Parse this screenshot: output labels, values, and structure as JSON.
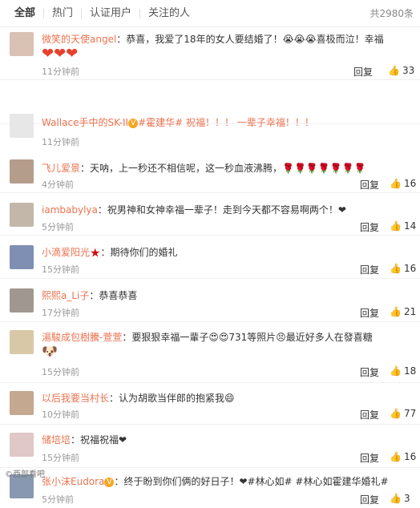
{
  "tabs": [
    {
      "label": "全部"
    },
    {
      "label": "热门"
    },
    {
      "label": "认证用户"
    },
    {
      "label": "关注的人"
    }
  ],
  "total_count": "共2980条",
  "reply_label": "回复",
  "comments": [
    {
      "user": "微笑的天使angel",
      "text": "：恭喜，我爱了18年的女人要结婚了！😭😭😭喜极而泣！幸福",
      "tail": "❤❤❤",
      "time": "11分钟前",
      "likes": "33",
      "avatar_color": "#d9c1b3"
    },
    {
      "user": "Wallace手中的SK-II",
      "text": "#霍建华# 祝福！！！ 一辈子幸福！！！",
      "time": "11分钟前",
      "likes": "",
      "avatar_color": "#e7e7e7"
    },
    {
      "user": "飞儿爱景",
      "text": "：天呐，上一秒还不相信呢，这一秒血液沸腾，🌹🌹🌹🌹🌹🌹🌹",
      "time": "4分钟前",
      "likes": "16",
      "avatar_color": "#b59d8c"
    },
    {
      "user": "iambabylya",
      "text": "：祝男神和女神幸福一辈子！走到今天都不容易啊两个！❤",
      "time": "5分钟前",
      "likes": "14",
      "avatar_color": "#c2b7a8"
    },
    {
      "user": "小滴爱阳光",
      "text": "：期待你们的婚礼",
      "time": "15分钟前",
      "likes": "16",
      "avatar_color": "#7f8fb3"
    },
    {
      "user": "熙熙a_Li子",
      "text": "：恭喜恭喜",
      "time": "17分钟前",
      "likes": "21",
      "avatar_color": "#a09890"
    },
    {
      "user": "湯駿成包樹騰-萱萱",
      "text": "：要狠狠幸福一輩子😍😍731等照片😣最近好多人在發喜糖",
      "time": "15分钟前",
      "likes": "18",
      "avatar_color": "#d8c8a8"
    },
    {
      "user": "以后我要当村长",
      "text": "：认为胡歌当伴郎的抱紧我😄",
      "time": "10分钟前",
      "likes": "77",
      "avatar_color": "#c4a890"
    },
    {
      "user": "储培培",
      "text": "：祝福祝福❤",
      "time": "15分钟前",
      "likes": "16",
      "avatar_color": "#e0c8c8"
    },
    {
      "user": "张小沫Eudora",
      "text": "：终于盼到你们俩的好日子！❤#林心如# #林心如霍建华婚礼#",
      "time": "5分钟前",
      "likes": "3",
      "avatar_color": "#8898b0"
    }
  ],
  "watermark": "©西部看吧"
}
